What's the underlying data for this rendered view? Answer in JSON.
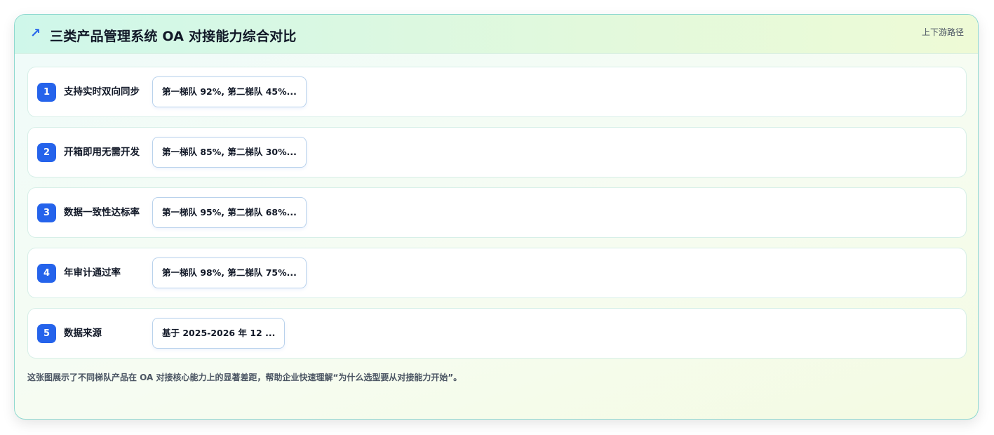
{
  "header": {
    "icon": "trend-arrow-icon",
    "title": "三类产品管理系统 OA 对接能力综合对比",
    "link": "上下游路径"
  },
  "rows": [
    {
      "index": "1",
      "label": "支持实时双向同步",
      "value": "第一梯队 92%, 第二梯队 45%..."
    },
    {
      "index": "2",
      "label": "开箱即用无需开发",
      "value": "第一梯队 85%, 第二梯队 30%..."
    },
    {
      "index": "3",
      "label": "数据一致性达标率",
      "value": "第一梯队 95%, 第二梯队 68%..."
    },
    {
      "index": "4",
      "label": "年审计通过率",
      "value": "第一梯队 98%, 第二梯队 75%..."
    },
    {
      "index": "5",
      "label": "数据来源",
      "value": "基于 2025-2026 年 12 ..."
    }
  ],
  "footnote": "这张图展示了不同梯队产品在 OA 对接核心能力上的显著差距，帮助企业快速理解“为什么选型要从对接能力开始”。",
  "colors": {
    "accent": "#2563eb",
    "border": "#8ed8cf"
  }
}
